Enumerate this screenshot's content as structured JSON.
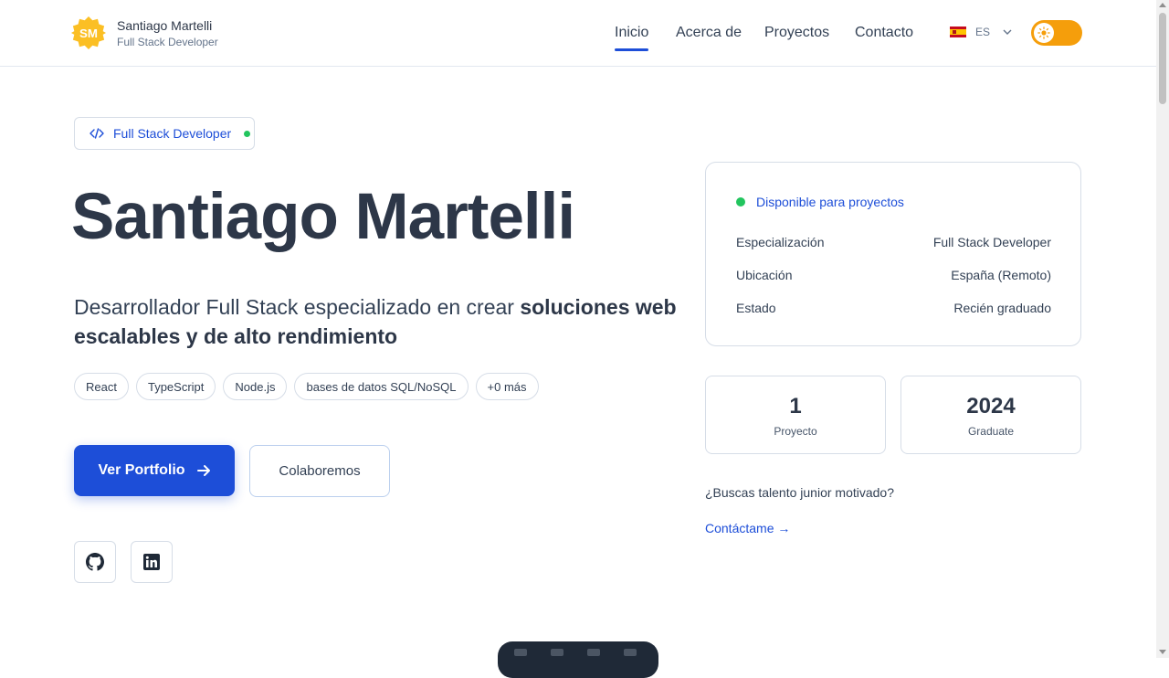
{
  "header": {
    "logo_text": "SM",
    "name": "Santiago Martelli",
    "subtitle": "Full Stack Developer",
    "nav": [
      "Inicio",
      "Acerca de",
      "Proyectos",
      "Contacto"
    ],
    "active_nav": "Inicio",
    "language": "ES",
    "theme_toggle_icon": "sun-icon"
  },
  "hero": {
    "badge": "Full Stack Developer",
    "title": "Santiago Martelli",
    "subtitle_plain": "Desarrollador Full Stack especializado en crear ",
    "subtitle_bold": "soluciones web escalables y de alto rendimiento",
    "chips": [
      "React",
      "TypeScript",
      "Node.js",
      "bases de datos SQL/NoSQL",
      "+0 más"
    ],
    "primary_button": "Ver Portfolio",
    "secondary_button": "Colaboremos",
    "social": [
      "github-icon",
      "linkedin-icon"
    ]
  },
  "info_card": {
    "status": "Disponible para proyectos",
    "rows": [
      {
        "label": "Especialización",
        "value": "Full Stack Developer"
      },
      {
        "label": "Ubicación",
        "value": "España (Remoto)"
      },
      {
        "label": "Estado",
        "value": "Recién graduado"
      }
    ]
  },
  "stats": [
    {
      "value": "1",
      "label": "Proyecto"
    },
    {
      "value": "2024",
      "label": "Graduate"
    }
  ],
  "cta": {
    "question": "¿Buscas talento junior motivado?",
    "link": "Contáctame →"
  },
  "colors": {
    "accent": "#1d4ed8",
    "status_green": "#22c55e",
    "toggle": "#f59e0b",
    "text_dark": "#2d3748"
  }
}
